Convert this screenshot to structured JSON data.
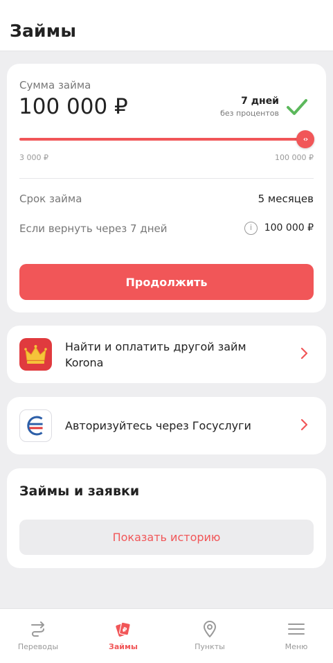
{
  "header": {
    "title": "Займы"
  },
  "loan": {
    "amount_label": "Сумма займа",
    "amount_value": "100 000 ₽",
    "promo_days": "7 дней",
    "promo_sub": "без процентов",
    "slider": {
      "min_label": "3 000 ₽",
      "max_label": "100 000 ₽",
      "fill_fraction": 1.0,
      "thumb_symbol": "‹›"
    },
    "term_label": "Срок займа",
    "term_value": "5 месяцев",
    "return_label": "Если вернуть через 7 дней",
    "return_value": "100 000 ₽",
    "continue_label": "Продолжить"
  },
  "korona": {
    "text": "Найти и оплатить другой займ Korona",
    "icon": "crown-icon"
  },
  "gosuslugi": {
    "text": "Авторизуйтесь через Госуслуги",
    "icon": "gosuslugi-logo-icon"
  },
  "history": {
    "title": "Займы и заявки",
    "button_label": "Показать историю"
  },
  "tabbar": {
    "items": [
      {
        "label": "Переводы",
        "icon": "transfer-icon"
      },
      {
        "label": "Займы",
        "icon": "loans-icon",
        "active": true
      },
      {
        "label": "Пункты",
        "icon": "location-pin-icon"
      },
      {
        "label": "Меню",
        "icon": "hamburger-menu-icon"
      }
    ]
  },
  "colors": {
    "accent": "#f15658",
    "check_green": "#5cb85c",
    "background": "#eeeef0"
  }
}
